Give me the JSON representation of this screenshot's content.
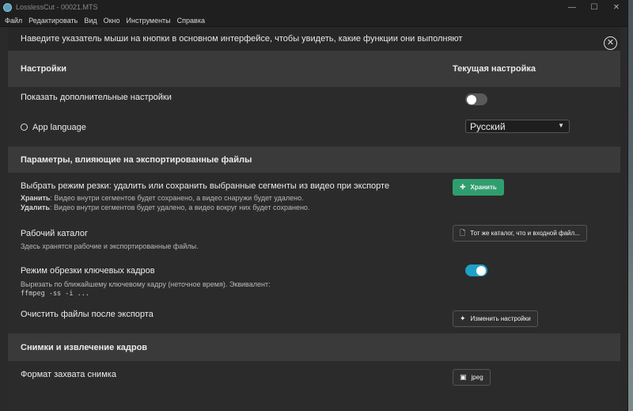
{
  "window": {
    "title": "LosslessCut - 00021.MTS",
    "controls": {
      "minimize": "—",
      "maximize": "☐",
      "close": "✕"
    }
  },
  "menu": [
    "Файл",
    "Редактировать",
    "Вид",
    "Окно",
    "Инструменты",
    "Справка"
  ],
  "hint": {
    "text": "Наведите указатель мыши на кнопки в основном интерфейсе, чтобы увидеть, какие функции они выполняют",
    "close_glyph": "✕"
  },
  "header": {
    "left": "Настройки",
    "right": "Текущая настройка"
  },
  "rows": {
    "advanced": {
      "title": "Показать дополнительные настройки",
      "enabled": false
    },
    "language": {
      "title": "App language",
      "value": "Русский",
      "caret": "▼"
    }
  },
  "section_export": {
    "title": "Параметры, влияющие на экспортированные файлы",
    "cut_mode": {
      "title": "Выбрать режим резки: удалить или сохранить выбранные сегменты из видео при экспорте",
      "keep_label": "Хранить",
      "keep_text": ": Видео внутри сегментов будет сохранено, а видео снаружи будет удалено.",
      "delete_label": "Удалить",
      "delete_text": ": Видео внутри сегментов будет удалено, а видео вокруг них будет сохранено.",
      "button": "Хранить",
      "button_icon": "✚"
    },
    "workdir": {
      "title": "Рабочий каталог",
      "desc": "Здесь хранятся рабочие и экспортированные файлы.",
      "button": "Тот же каталог, что и входной файл...",
      "button_icon": "🗋"
    },
    "keyframe": {
      "title": "Режим обрезки ключевых кадров",
      "desc": "Вырезать по ближайшему ключевому кадру (неточное время). Эквивалент:",
      "code": "ffmpeg -ss -i ...",
      "enabled": true
    },
    "cleanup": {
      "title": "Очистить файлы после экспорта",
      "button": "Изменить настройки",
      "button_icon": "✦"
    }
  },
  "section_snapshot": {
    "title": "Снимки и извлечение кадров",
    "format": {
      "title": "Формат захвата снимка",
      "button": "jpeg",
      "button_icon": "▣"
    }
  },
  "colors": {
    "accent_green": "#2f9e6e",
    "toggle_on": "#1fa0c8",
    "panel": "#2b2b2b",
    "section": "#3a3a3a"
  }
}
